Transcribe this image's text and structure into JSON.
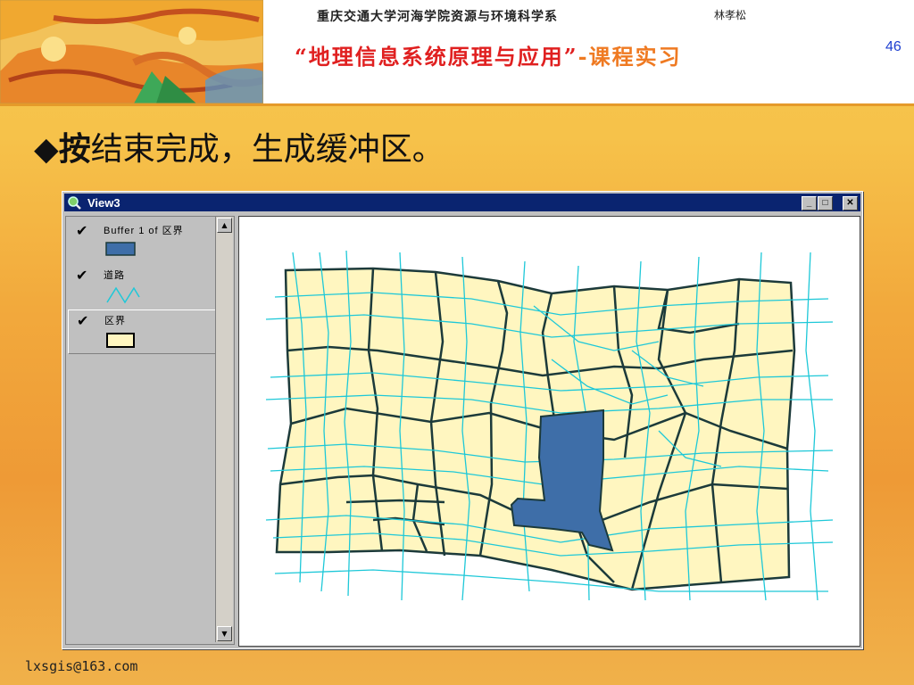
{
  "header": {
    "school_title": "重庆交通大学河海学院资源与环境科学系",
    "author": "林孝松",
    "course_title_main": "“地理信息系统原理与应用”",
    "course_title_suffix": "-课程实习",
    "page_number": "46"
  },
  "slide": {
    "bullet_bold": "按",
    "bullet_rest": "结束完成，生成缓冲区。"
  },
  "window": {
    "title": "View3",
    "minimize_label": "_",
    "maximize_label": "□",
    "close_label": "✕",
    "layers": [
      {
        "label": "Buffer 1 of 区界",
        "checked": true,
        "symbol": "fill",
        "color": "#3e6ea8"
      },
      {
        "label": "道路",
        "checked": true,
        "symbol": "line",
        "color": "#1ec8d8"
      },
      {
        "label": "区界",
        "checked": true,
        "symbol": "fill",
        "color": "#fff6c0"
      }
    ]
  },
  "colors": {
    "district_fill": "#fff6c0",
    "district_border": "#1c3a3a",
    "road": "#1ec8d8",
    "buffer": "#3e6ea8",
    "title_red": "#e02020"
  },
  "footer": {
    "email": "lxsgis@163.com"
  }
}
